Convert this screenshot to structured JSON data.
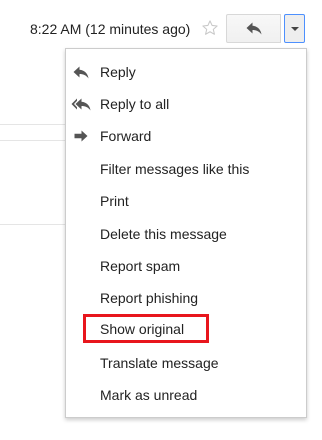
{
  "header": {
    "timestamp": "8:22 AM (12 minutes ago)",
    "star_icon": "star-outline-icon",
    "reply_icon": "reply-arrow-icon",
    "dropdown_icon": "caret-down-icon"
  },
  "menu": {
    "items": [
      {
        "label": "Reply",
        "icon": "reply-icon"
      },
      {
        "label": "Reply to all",
        "icon": "reply-all-icon"
      },
      {
        "label": "Forward",
        "icon": "forward-icon"
      },
      {
        "label": "Filter messages like this",
        "icon": ""
      },
      {
        "label": "Print",
        "icon": ""
      },
      {
        "label": "Delete this message",
        "icon": ""
      },
      {
        "label": "Report spam",
        "icon": ""
      },
      {
        "label": "Report phishing",
        "icon": ""
      },
      {
        "label": "Show original",
        "icon": "",
        "highlighted": true
      },
      {
        "label": "Translate message",
        "icon": ""
      },
      {
        "label": "Mark as unread",
        "icon": ""
      }
    ]
  },
  "colors": {
    "highlight_border": "#e8161d",
    "focus_border": "#4d90fe",
    "text": "#222222",
    "icon": "#555555"
  }
}
